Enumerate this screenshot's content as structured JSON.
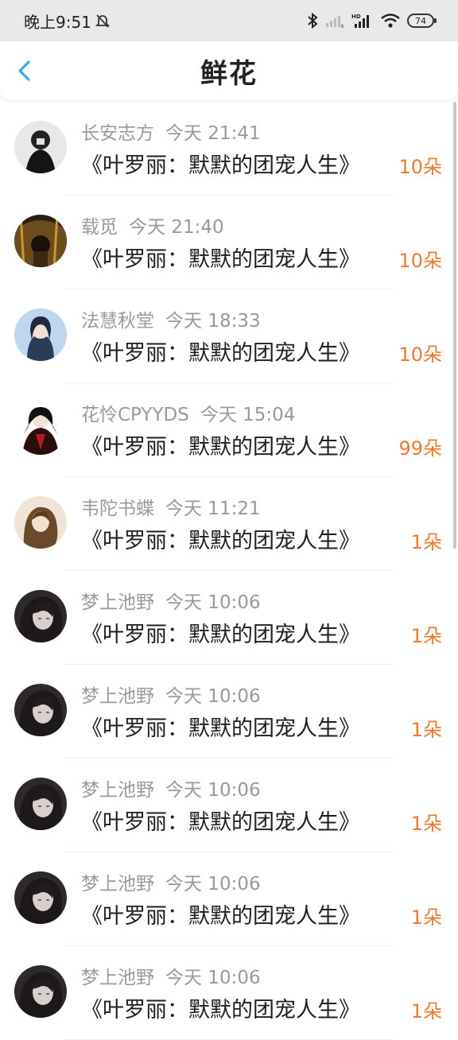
{
  "status_bar": {
    "time": "晚上9:51",
    "battery": "74",
    "hd_label": "HD"
  },
  "header": {
    "title": "鲜花"
  },
  "colors": {
    "accent": "#3fa6e6",
    "count": "#ef7a2e",
    "meta": "#9a9a9a"
  },
  "items": [
    {
      "user": "长安志方",
      "time": "今天 21:41",
      "book": "《叶罗丽：默默的团宠人生》",
      "count": "10朵",
      "avatar": "a1"
    },
    {
      "user": "载觅",
      "time": "今天 21:40",
      "book": "《叶罗丽：默默的团宠人生》",
      "count": "10朵",
      "avatar": "a2"
    },
    {
      "user": "法慧秋堂",
      "time": "今天 18:33",
      "book": "《叶罗丽：默默的团宠人生》",
      "count": "10朵",
      "avatar": "a3"
    },
    {
      "user": "花怜CPYYDS",
      "time": "今天 15:04",
      "book": "《叶罗丽：默默的团宠人生》",
      "count": "99朵",
      "avatar": "a4"
    },
    {
      "user": "韦陀书蝶",
      "time": "今天 11:21",
      "book": "《叶罗丽：默默的团宠人生》",
      "count": "1朵",
      "avatar": "a5"
    },
    {
      "user": "梦上池野",
      "time": "今天 10:06",
      "book": "《叶罗丽：默默的团宠人生》",
      "count": "1朵",
      "avatar": "a6"
    },
    {
      "user": "梦上池野",
      "time": "今天 10:06",
      "book": "《叶罗丽：默默的团宠人生》",
      "count": "1朵",
      "avatar": "a6"
    },
    {
      "user": "梦上池野",
      "time": "今天 10:06",
      "book": "《叶罗丽：默默的团宠人生》",
      "count": "1朵",
      "avatar": "a6"
    },
    {
      "user": "梦上池野",
      "time": "今天 10:06",
      "book": "《叶罗丽：默默的团宠人生》",
      "count": "1朵",
      "avatar": "a6"
    },
    {
      "user": "梦上池野",
      "time": "今天 10:06",
      "book": "《叶罗丽：默默的团宠人生》",
      "count": "1朵",
      "avatar": "a6"
    }
  ]
}
